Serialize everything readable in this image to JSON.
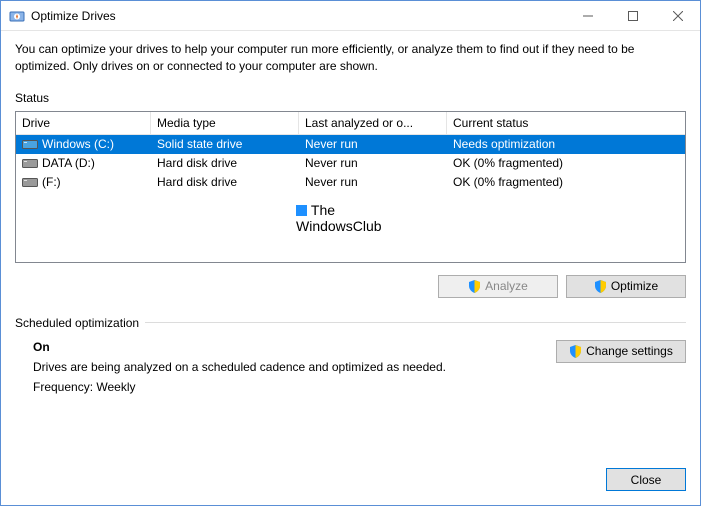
{
  "window": {
    "title": "Optimize Drives"
  },
  "description": "You can optimize your drives to help your computer run more efficiently, or analyze them to find out if they need to be optimized. Only drives on or connected to your computer are shown.",
  "status": {
    "label": "Status",
    "columns": {
      "drive": "Drive",
      "media": "Media type",
      "last": "Last analyzed or o...",
      "status": "Current status"
    },
    "rows": [
      {
        "drive": "Windows (C:)",
        "media": "Solid state drive",
        "last": "Never run",
        "status": "Needs optimization",
        "selected": true,
        "ssd": true
      },
      {
        "drive": "DATA (D:)",
        "media": "Hard disk drive",
        "last": "Never run",
        "status": "OK (0% fragmented)",
        "selected": false,
        "ssd": false
      },
      {
        "drive": "(F:)",
        "media": "Hard disk drive",
        "last": "Never run",
        "status": "OK (0% fragmented)",
        "selected": false,
        "ssd": false
      }
    ]
  },
  "watermark": {
    "line1": "The",
    "line2": "WindowsClub"
  },
  "buttons": {
    "analyze": "Analyze",
    "optimize": "Optimize",
    "change": "Change settings",
    "close": "Close"
  },
  "scheduled": {
    "label": "Scheduled optimization",
    "state": "On",
    "desc": "Drives are being analyzed on a scheduled cadence and optimized as needed.",
    "freq": "Frequency: Weekly"
  }
}
